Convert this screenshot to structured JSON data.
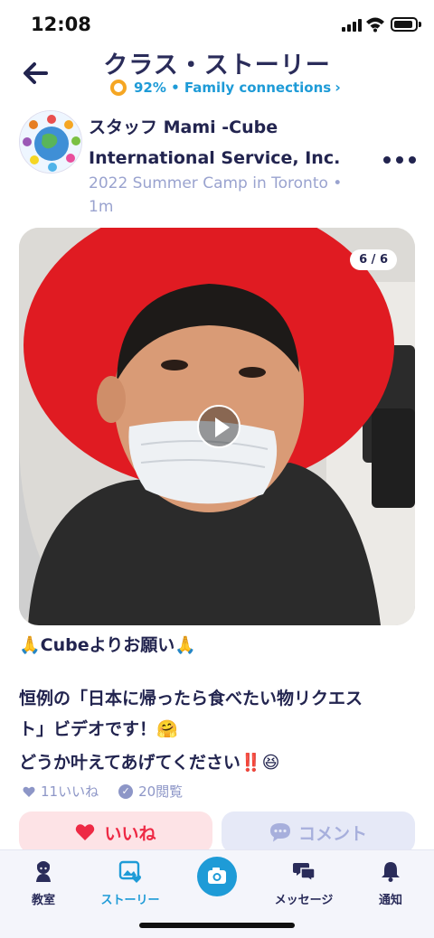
{
  "status_bar": {
    "time": "12:08"
  },
  "header": {
    "title": "クラス・ストーリー",
    "family_connections": "92% • Family connections",
    "family_chevron": "›"
  },
  "post": {
    "author_line1": "スタッフ Mami -Cube",
    "author_line2": "International Service, Inc.",
    "meta_line1": "2022 Summer Camp in Toronto •",
    "meta_line2": "1m",
    "media_counter": "6 / 6",
    "text_line1": "Cubeよりお願い",
    "text_line1_emoji_left": "🙏",
    "text_line1_emoji_right": "🙏",
    "text_line2": "恒例の「日本に帰ったら食べたい物リクエス",
    "text_line3": "ト」ビデオです！",
    "text_line3_emoji": "🤗",
    "text_line4": "どうか叶えてあげてください",
    "text_line4_marks": "‼️",
    "text_line4_emoji": "😆",
    "likes": "11いいね",
    "views": "20閲覧",
    "like_button": "いいね",
    "comment_button": "コメント"
  },
  "tabbar": {
    "tabs": [
      {
        "label": "教室",
        "icon": "classroom-icon"
      },
      {
        "label": "ストーリー",
        "icon": "story-icon"
      },
      {
        "label": "",
        "icon": "camera-icon"
      },
      {
        "label": "メッセージ",
        "icon": "message-icon"
      },
      {
        "label": "通知",
        "icon": "bell-icon"
      }
    ]
  },
  "colors": {
    "primary": "#1e9bd7",
    "navy": "#2a2c5a",
    "like_red": "#ee2a45",
    "muted": "#9aa3cf",
    "ring": "#f5a623"
  }
}
